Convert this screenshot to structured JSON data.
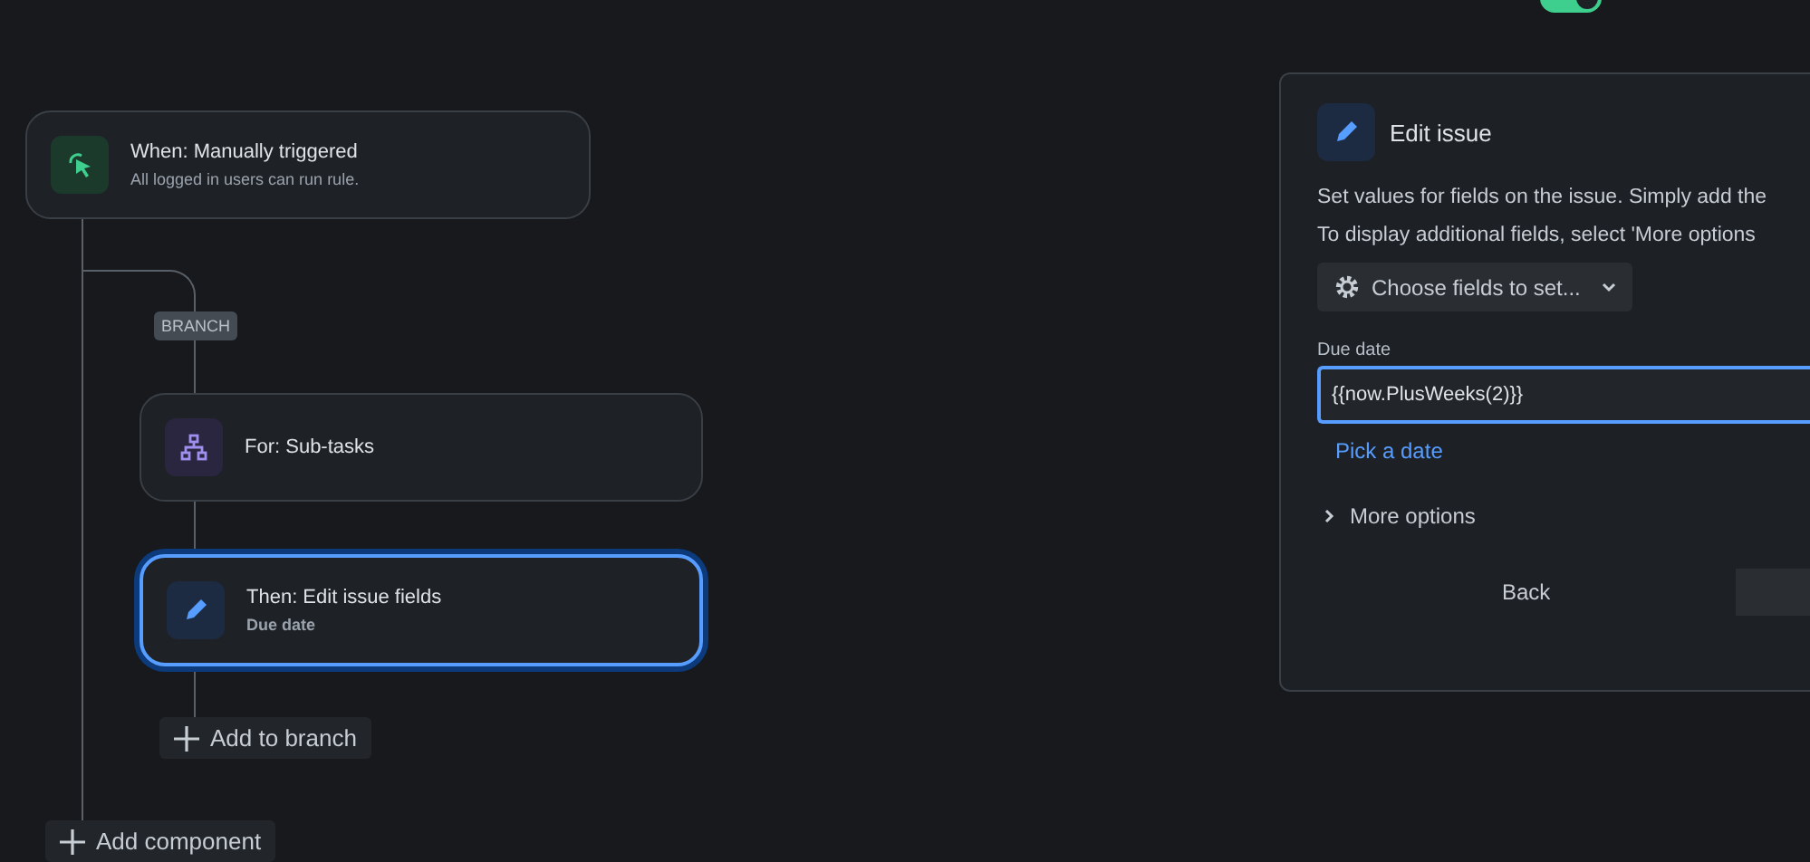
{
  "header": {
    "rule_enabled": {
      "on": true
    }
  },
  "canvas": {
    "trigger": {
      "title": "When: Manually triggered",
      "subtitle": "All logged in users can run rule."
    },
    "branch": {
      "tag": "BRANCH",
      "nodes": [
        {
          "kind": "loop",
          "title": "For: Sub-tasks",
          "selected": false
        },
        {
          "kind": "action",
          "title": "Then: Edit issue fields",
          "subtitle": "Due date",
          "selected": true
        }
      ],
      "add_label": "Add to branch"
    },
    "add_component": "Add component"
  },
  "panel": {
    "title": "Edit issue",
    "paragraphs": [
      "Set values for fields on the issue. Simply add the",
      "To display additional fields, select 'More options"
    ],
    "choose_fields": "Choose fields to set...",
    "field": {
      "label": "Due date",
      "value": "{{now.PlusWeeks(2)}}",
      "link": "Pick a date"
    },
    "more_options": {
      "label": "More options",
      "expanded": false
    },
    "buttons": [
      "Back"
    ]
  }
}
